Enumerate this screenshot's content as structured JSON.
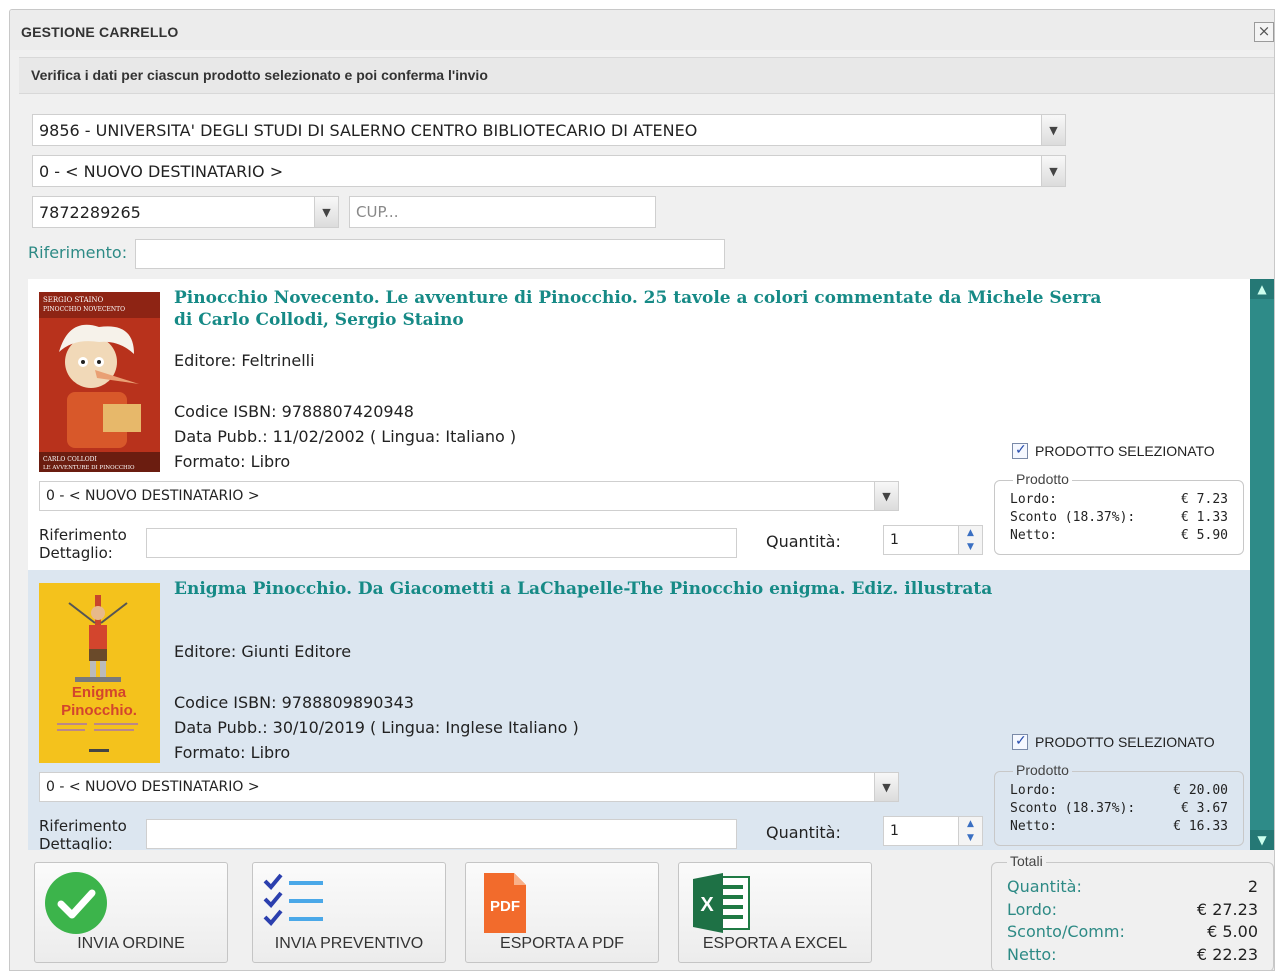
{
  "window": {
    "title": "GESTIONE CARRELLO",
    "close_glyph": "×"
  },
  "subheader": "Verifica i dati per ciascun prodotto selezionato e poi conferma l'invio",
  "form": {
    "ente": "9856 - UNIVERSITA' DEGLI STUDI DI SALERNO CENTRO BIBLIOTECARIO DI ATENEO",
    "destinatario": "0 - < NUOVO DESTINATARIO >",
    "cig": "7872289265",
    "cup_placeholder": "CUP...",
    "riferimento_label": "Riferimento:"
  },
  "products": [
    {
      "title": "Pinocchio Novecento. Le avventure di Pinocchio. 25 tavole a colori commentate da Michele Serra",
      "authors": "di Carlo Collodi, Sergio Staino",
      "editore": "Editore: Feltrinelli",
      "isbn": "Codice ISBN: 9788807420948",
      "data_pubb": "Data Pubb.: 11/02/2002 ( Lingua: Italiano )",
      "formato": "Formato: Libro",
      "cover_top_text": "SERGIO STAINO",
      "cover_top_text2": "PINOCCHIO NOVECENTO",
      "cover_bottom_text": "CARLO COLLODI",
      "cover_bottom_text2": "LE AVVENTURE DI PINOCCHIO",
      "selected_label": "PRODOTTO SELEZIONATO",
      "selected": true,
      "destinatario": "0 - < NUOVO DESTINATARIO >",
      "rif_label_1": "Riferimento",
      "rif_label_2": "Dettaglio:",
      "qty_label": "Quantità:",
      "qty": "1",
      "box_legend": "Prodotto",
      "lordo_label": "Lordo:",
      "lordo": "€ 7.23",
      "sconto_label": "Sconto (18.37%):",
      "sconto": "€ 1.33",
      "netto_label": "Netto:",
      "netto": "€ 5.90",
      "cover_color": "#b8321c"
    },
    {
      "title": "Enigma Pinocchio. Da Giacometti a LaChapelle-The Pinocchio enigma. Ediz. illustrata",
      "authors": "",
      "editore": "Editore: Giunti Editore",
      "isbn": "Codice ISBN: 9788809890343",
      "data_pubb": "Data Pubb.: 30/10/2019 ( Lingua: Inglese Italiano )",
      "formato": "Formato: Libro",
      "cover_title_1": "Enigma",
      "cover_title_2": "Pinocchio.",
      "selected_label": "PRODOTTO SELEZIONATO",
      "selected": true,
      "destinatario": "0 - < NUOVO DESTINATARIO >",
      "rif_label_1": "Riferimento",
      "rif_label_2": "Dettaglio:",
      "qty_label": "Quantità:",
      "qty": "1",
      "box_legend": "Prodotto",
      "lordo_label": "Lordo:",
      "lordo": "€ 20.00",
      "sconto_label": "Sconto (18.37%):",
      "sconto": "€ 3.67",
      "netto_label": "Netto:",
      "netto": "€ 16.33",
      "cover_color": "#f4c21c"
    }
  ],
  "actions": {
    "invia_ordine": "INVIA ORDINE",
    "invia_preventivo": "INVIA PREVENTIVO",
    "esporta_pdf": "ESPORTA A PDF",
    "esporta_excel": "ESPORTA A EXCEL",
    "pdf_icon_text": "PDF",
    "excel_icon_text": "X"
  },
  "totals": {
    "legend": "Totali",
    "quantita_label": "Quantità:",
    "quantita": "2",
    "lordo_label": "Lordo:",
    "lordo": "€ 27.23",
    "sconto_label": "Sconto/Comm:",
    "sconto": "€ 5.00",
    "netto_label": "Netto:",
    "netto": "€ 22.23"
  },
  "colors": {
    "accent": "#168a86",
    "scrollbar": "#2e8b88",
    "selected_row": "#dce6f0",
    "ok_green": "#3cb44b"
  }
}
